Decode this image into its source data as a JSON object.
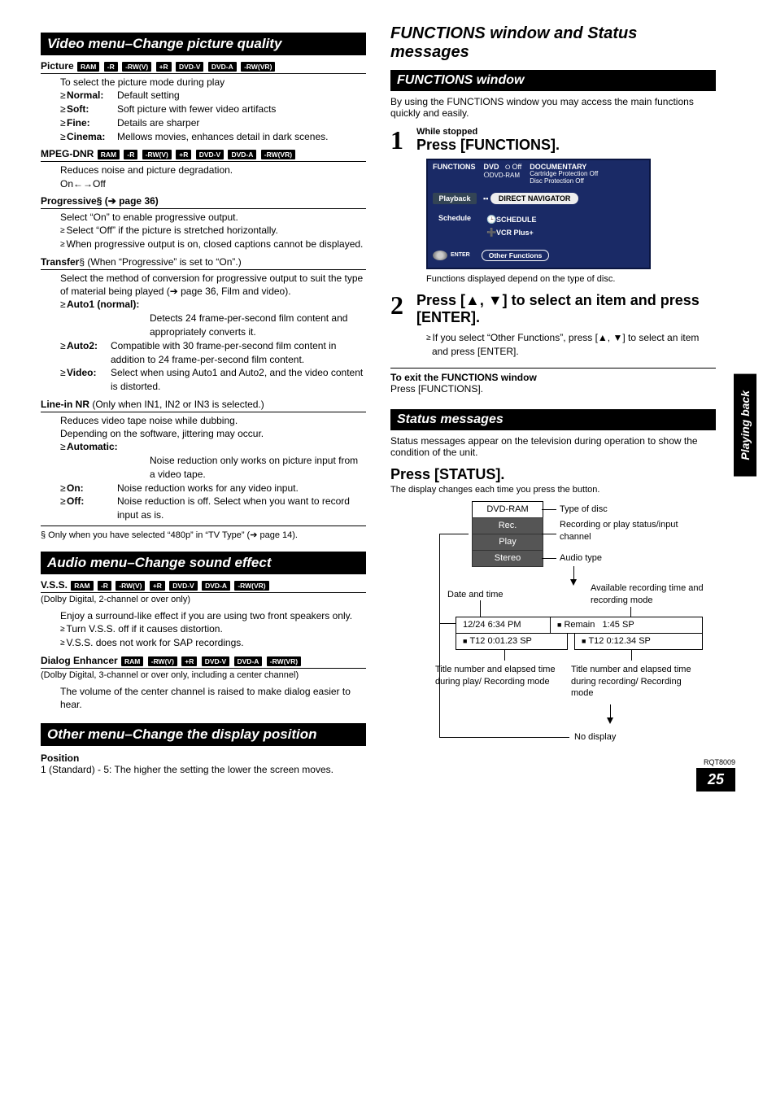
{
  "left": {
    "title_video": "Video menu–Change picture quality",
    "picture": {
      "name": "Picture",
      "formats": [
        "RAM",
        "-R",
        "-RW(V)",
        "+R",
        "DVD-V",
        "DVD-A",
        "-RW(VR)"
      ],
      "intro": "To select the picture mode during play",
      "items": [
        {
          "label": "Normal:",
          "text": "Default setting"
        },
        {
          "label": "Soft:",
          "text": "Soft picture with fewer video artifacts"
        },
        {
          "label": "Fine:",
          "text": "Details are sharper"
        },
        {
          "label": "Cinema:",
          "text": "Mellows movies, enhances detail in dark scenes."
        }
      ]
    },
    "mpeg": {
      "name": "MPEG-DNR",
      "formats": [
        "RAM",
        "-R",
        "-RW(V)",
        "+R",
        "DVD-V",
        "DVD-A",
        "-RW(VR)"
      ],
      "line1": "Reduces noise and picture degradation.",
      "line2": "On←→Off"
    },
    "progressive": {
      "name": "Progressive§ (➔ page 36)",
      "line1": "Select “On” to enable progressive output.",
      "b1": "Select “Off” if the picture is stretched horizontally.",
      "b2": "When progressive output is on, closed captions cannot be displayed."
    },
    "transfer": {
      "name": "Transfer§ (When “Progressive” is set to “On”.)",
      "line1": "Select the method of conversion for progressive output to suit the type of material being played (➔ page 36, Film and video).",
      "items": [
        {
          "label": "Auto1 (normal):",
          "text": "Detects 24 frame-per-second film content and appropriately converts it.",
          "wide": true
        },
        {
          "label": "Auto2:",
          "text": "Compatible with 30 frame-per-second film content in addition to 24 frame-per-second film content."
        },
        {
          "label": "Video:",
          "text": "Select when using Auto1 and Auto2, and the video content is distorted."
        }
      ]
    },
    "linein": {
      "name": "Line-in NR (Only when IN1, IN2 or IN3 is selected.)",
      "line1": "Reduces video tape noise while dubbing.",
      "line2": "Depending on the software, jittering may occur.",
      "items": [
        {
          "label": "Automatic:",
          "text": "Noise reduction only works on picture input from a video tape.",
          "wide": true
        },
        {
          "label": "On:",
          "text": "Noise reduction works for any video input."
        },
        {
          "label": "Off:",
          "text": "Noise reduction is off. Select when you want to record input as is."
        }
      ],
      "footnote": "§ Only when you have selected “480p” in “TV Type” (➔ page 14)."
    },
    "title_audio": "Audio menu–Change sound effect",
    "vss": {
      "name": "V.S.S.",
      "formats": [
        "RAM",
        "-R",
        "-RW(V)",
        "+R",
        "DVD-V",
        "DVD-A",
        "-RW(VR)"
      ],
      "sub": "(Dolby Digital, 2-channel or over only)",
      "line1": "Enjoy a surround-like effect if you are using two front speakers only.",
      "b1": "Turn V.S.S. off if it causes distortion.",
      "b2": "V.S.S. does not work for SAP recordings."
    },
    "dialog": {
      "name": "Dialog Enhancer",
      "formats": [
        "RAM",
        "-RW(V)",
        "+R",
        "DVD-V",
        "DVD-A",
        "-RW(VR)"
      ],
      "sub": "(Dolby Digital, 3-channel or over only, including a center channel)",
      "line1": "The volume of the center channel is raised to make dialog easier to hear."
    },
    "title_other": "Other menu–Change the display position",
    "position": {
      "name": "Position",
      "line1": "1 (Standard) - 5: The higher the setting the lower the screen moves."
    }
  },
  "right": {
    "super_title": "FUNCTIONS window and Status messages",
    "title_fn": "FUNCTIONS window",
    "fn_intro": "By using the FUNCTIONS window you may access the main functions quickly and easily.",
    "step1": {
      "num": "1",
      "small": "While stopped",
      "main": "Press [FUNCTIONS].",
      "caption": "Functions displayed depend on the type of disc."
    },
    "fnbox": {
      "hdr_fn": "FUNCTIONS",
      "hdr_dvd": "DVD",
      "hdr_off": "Off",
      "hdr_dvdram": "DVD-RAM",
      "hdr_doc": "DOCUMENTARY",
      "hdr_cart": "Cartridge Protection  Off",
      "hdr_disc": "Disc Protection  Off",
      "tab_play": "Playback",
      "pill_dn": "DIRECT NAVIGATOR",
      "tab_sched": "Schedule",
      "item_sched": "SCHEDULE",
      "item_vcr": "VCR Plus+",
      "enter": "ENTER",
      "other": "Other Functions"
    },
    "step2": {
      "num": "2",
      "main": "Press [▲, ▼] to select an item and press [ENTER].",
      "bullet": "If you select “Other Functions”, press [▲, ▼] to select an item and press [ENTER]."
    },
    "exit": {
      "head": "To exit the FUNCTIONS window",
      "text": "Press [FUNCTIONS]."
    },
    "title_status": "Status messages",
    "status_intro": "Status messages appear on the television during operation to show the condition of the unit.",
    "press_status": "Press [STATUS].",
    "press_status_sub": "The display changes each time you press the button.",
    "diagram": {
      "dvdram": "DVD-RAM",
      "rec": "Rec.",
      "play": "Play",
      "stereo": "Stereo",
      "type_disc": "Type of disc",
      "rec_status": "Recording or play status/input channel",
      "audio_type": "Audio type",
      "avail": "Available recording time and recording mode",
      "date_time": "Date and time",
      "time_row": "12/24  6:34 PM",
      "remain": "Remain",
      "remain_val": "1:45  SP",
      "left_t": "T12  0:01.23  SP",
      "right_t": "T12  0:12.34  SP",
      "left_label": "Title number and elapsed time during play/ Recording mode",
      "right_label": "Title number and elapsed time during recording/ Recording mode",
      "no_display": "No display"
    },
    "side_tab": "Playing back",
    "rqt": "RQT8009",
    "page_num": "25"
  }
}
